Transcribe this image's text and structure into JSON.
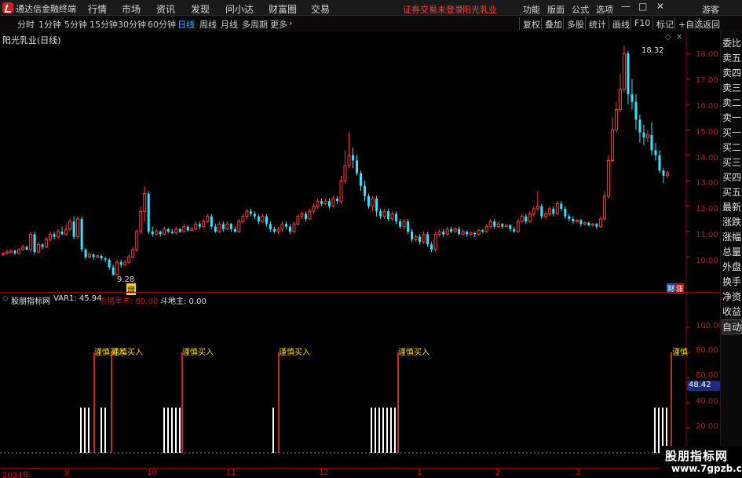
{
  "app": {
    "title": "通达信金融终端",
    "menu": [
      "行情",
      "市场",
      "资讯",
      "发现",
      "问小达",
      "财富圈",
      "交易"
    ],
    "login_status": "证券交易未登录",
    "stock_name": "阳光乳业",
    "right_menu": [
      "功能",
      "版面",
      "公式",
      "选项"
    ],
    "user": "游客"
  },
  "toolbar": {
    "periods": [
      "分时",
      "1分钟",
      "5分钟",
      "15分钟",
      "30分钟",
      "60分钟",
      "日线",
      "周线",
      "月线",
      "多周期",
      "更多"
    ],
    "active_period": "日线",
    "right_buttons": [
      "复权",
      "叠加",
      "多股",
      "统计",
      "画线",
      "F10",
      "标记",
      "+自选",
      "返回"
    ]
  },
  "main_chart": {
    "title": "阳光乳业(日线)",
    "high_label": "18.32",
    "low_label": "9.28",
    "yticks": [
      "18.00",
      "17.00",
      "16.00",
      "15.00",
      "14.00",
      "13.00",
      "12.00",
      "11.00",
      "10.00"
    ],
    "marker_text": "增",
    "corner_tags": [
      "财",
      "涨"
    ]
  },
  "indicator": {
    "name": "股朋指标网",
    "var1_label": "VAR1: 45.94",
    "sell_label": "杀猪宰羊: 80.00",
    "floor_label": "斗地主: 0.00",
    "value_tag": "48.42",
    "buy_signal_texts": [
      "谨慎买入",
      "谨慎买入",
      "谨慎买入",
      "谨慎买入",
      "谨慎买入",
      "谨慎"
    ],
    "yticks": [
      "100.00",
      "80.00",
      "60.00",
      "40.00",
      "20.00"
    ]
  },
  "xaxis": {
    "labels": [
      "2024年",
      "9",
      "10",
      "11",
      "12",
      "1",
      "2",
      "3"
    ]
  },
  "side_panel": {
    "items": [
      "委比",
      "卖五",
      "卖四",
      "卖三",
      "卖二",
      "卖一",
      "买一",
      "买二",
      "买三",
      "买四",
      "买五",
      "最新",
      "涨跌",
      "涨幅",
      "总量",
      "外盘",
      "换手",
      "净资",
      "收益"
    ],
    "auto_button": "自动"
  },
  "watermark": {
    "title": "股朋指标网",
    "url": "www.7gpzb.com"
  },
  "colors": {
    "up": "#ff3a3a",
    "down": "#33e6ff",
    "axis": "#c01818",
    "signal": "#ffd21a",
    "background": "#000000"
  },
  "chart_data": {
    "type": "candlestick",
    "title": "阳光乳业(日线)",
    "ylim": [
      9.0,
      18.5
    ],
    "candles": [
      [
        10.1,
        10.15,
        10.2,
        10.05
      ],
      [
        10.15,
        10.2,
        10.3,
        10.1
      ],
      [
        10.2,
        10.25,
        10.3,
        10.15
      ],
      [
        10.25,
        10.15,
        10.3,
        10.1
      ],
      [
        10.15,
        10.3,
        10.35,
        10.1
      ],
      [
        10.3,
        10.4,
        10.5,
        10.25
      ],
      [
        10.4,
        10.3,
        10.45,
        10.25
      ],
      [
        10.3,
        10.9,
        11.0,
        10.2
      ],
      [
        10.9,
        10.2,
        11.0,
        10.1
      ],
      [
        10.2,
        10.5,
        10.6,
        10.15
      ],
      [
        10.5,
        10.4,
        10.55,
        10.3
      ],
      [
        10.4,
        10.7,
        10.8,
        10.35
      ],
      [
        10.7,
        10.9,
        11.0,
        10.6
      ],
      [
        10.9,
        10.8,
        11.0,
        10.7
      ],
      [
        10.8,
        11.0,
        11.1,
        10.7
      ],
      [
        11.0,
        10.9,
        11.2,
        10.85
      ],
      [
        10.9,
        11.1,
        11.3,
        10.85
      ],
      [
        11.1,
        11.4,
        11.5,
        11.0
      ],
      [
        11.4,
        10.8,
        11.6,
        10.7
      ],
      [
        10.8,
        11.5,
        11.6,
        10.7
      ],
      [
        11.5,
        10.3,
        11.6,
        10.2
      ],
      [
        10.3,
        10.0,
        10.35,
        9.9
      ],
      [
        10.0,
        10.1,
        10.2,
        9.95
      ],
      [
        10.1,
        10.0,
        10.15,
        9.9
      ],
      [
        10.0,
        10.05,
        10.1,
        9.95
      ],
      [
        10.05,
        9.95,
        10.1,
        9.85
      ],
      [
        9.95,
        9.9,
        10.0,
        9.8
      ],
      [
        9.9,
        9.6,
        9.95,
        9.5
      ],
      [
        9.6,
        9.3,
        9.7,
        9.28
      ],
      [
        9.3,
        9.8,
        9.9,
        9.28
      ],
      [
        9.8,
        9.7,
        9.9,
        9.6
      ],
      [
        9.7,
        9.8,
        9.9,
        9.65
      ],
      [
        9.8,
        10.0,
        10.1,
        9.75
      ],
      [
        10.0,
        10.3,
        10.4,
        9.95
      ],
      [
        10.3,
        11.0,
        11.1,
        10.2
      ],
      [
        11.0,
        11.8,
        12.0,
        10.9
      ],
      [
        11.8,
        12.5,
        12.8,
        11.4
      ],
      [
        12.5,
        11.0,
        12.6,
        10.9
      ],
      [
        11.0,
        10.9,
        11.2,
        10.8
      ],
      [
        10.9,
        11.0,
        11.1,
        10.85
      ],
      [
        11.0,
        10.9,
        11.05,
        10.8
      ],
      [
        10.9,
        11.1,
        11.2,
        10.85
      ],
      [
        11.1,
        11.0,
        11.15,
        10.95
      ],
      [
        11.0,
        10.95,
        11.1,
        10.9
      ],
      [
        10.95,
        11.1,
        11.2,
        10.9
      ],
      [
        11.1,
        11.0,
        11.15,
        10.95
      ],
      [
        11.0,
        11.2,
        11.3,
        10.95
      ],
      [
        11.2,
        11.05,
        11.25,
        11.0
      ],
      [
        11.05,
        11.1,
        11.2,
        11.0
      ],
      [
        11.1,
        11.3,
        11.4,
        11.05
      ],
      [
        11.3,
        11.2,
        11.4,
        11.1
      ],
      [
        11.2,
        11.4,
        11.5,
        11.15
      ],
      [
        11.4,
        11.6,
        11.7,
        11.35
      ],
      [
        11.6,
        11.2,
        11.7,
        11.1
      ],
      [
        11.2,
        11.0,
        11.3,
        10.95
      ],
      [
        11.0,
        11.3,
        11.4,
        10.95
      ],
      [
        11.3,
        11.1,
        11.4,
        11.0
      ],
      [
        11.1,
        11.3,
        11.4,
        11.05
      ],
      [
        11.3,
        11.1,
        11.35,
        11.0
      ],
      [
        11.1,
        11.0,
        11.2,
        10.95
      ],
      [
        11.0,
        11.4,
        11.5,
        10.95
      ],
      [
        11.4,
        11.6,
        11.7,
        11.35
      ],
      [
        11.6,
        11.8,
        11.9,
        11.5
      ],
      [
        11.8,
        11.7,
        11.9,
        11.6
      ],
      [
        11.7,
        11.6,
        11.8,
        11.5
      ],
      [
        11.6,
        11.4,
        11.7,
        11.3
      ],
      [
        11.4,
        11.6,
        11.7,
        11.35
      ],
      [
        11.6,
        11.3,
        11.7,
        11.2
      ],
      [
        11.3,
        11.1,
        11.4,
        11.0
      ],
      [
        11.1,
        11.0,
        11.2,
        10.95
      ],
      [
        11.0,
        11.1,
        11.2,
        10.9
      ],
      [
        11.1,
        11.3,
        11.4,
        11.0
      ],
      [
        11.3,
        11.2,
        11.4,
        11.1
      ],
      [
        11.2,
        11.0,
        11.3,
        10.9
      ],
      [
        11.0,
        11.3,
        11.4,
        10.95
      ],
      [
        11.3,
        11.6,
        11.7,
        11.25
      ],
      [
        11.6,
        11.7,
        11.8,
        11.5
      ],
      [
        11.7,
        11.5,
        11.8,
        11.4
      ],
      [
        11.5,
        11.8,
        11.9,
        11.45
      ],
      [
        11.8,
        12.0,
        12.1,
        11.7
      ],
      [
        12.0,
        12.2,
        12.3,
        11.9
      ],
      [
        12.2,
        12.1,
        12.3,
        12.0
      ],
      [
        12.1,
        12.2,
        12.3,
        12.05
      ],
      [
        12.2,
        12.0,
        12.3,
        11.9
      ],
      [
        12.0,
        12.3,
        12.4,
        11.95
      ],
      [
        12.3,
        12.2,
        12.4,
        12.1
      ],
      [
        12.2,
        13.0,
        13.2,
        12.1
      ],
      [
        13.0,
        13.6,
        14.2,
        12.9
      ],
      [
        13.6,
        14.0,
        14.9,
        13.5
      ],
      [
        14.0,
        13.8,
        14.3,
        13.5
      ],
      [
        13.8,
        13.3,
        14.0,
        13.2
      ],
      [
        13.3,
        12.8,
        13.4,
        12.6
      ],
      [
        12.8,
        12.4,
        13.0,
        12.2
      ],
      [
        12.4,
        12.0,
        12.5,
        11.9
      ],
      [
        12.0,
        12.3,
        12.4,
        11.8
      ],
      [
        12.3,
        11.8,
        12.4,
        11.6
      ],
      [
        11.8,
        11.6,
        11.9,
        11.5
      ],
      [
        11.6,
        11.8,
        11.9,
        11.5
      ],
      [
        11.8,
        11.5,
        11.9,
        11.4
      ],
      [
        11.5,
        11.7,
        11.8,
        11.4
      ],
      [
        11.7,
        11.4,
        11.8,
        11.3
      ],
      [
        11.4,
        11.2,
        11.5,
        11.1
      ],
      [
        11.2,
        11.4,
        11.5,
        11.1
      ],
      [
        11.4,
        11.0,
        11.5,
        10.9
      ],
      [
        11.0,
        10.7,
        11.1,
        10.6
      ],
      [
        10.7,
        10.8,
        10.9,
        10.6
      ],
      [
        10.8,
        10.6,
        10.9,
        10.5
      ],
      [
        10.6,
        10.9,
        11.0,
        10.5
      ],
      [
        10.9,
        10.5,
        11.0,
        10.4
      ],
      [
        10.5,
        10.3,
        10.6,
        10.2
      ],
      [
        10.3,
        10.9,
        11.0,
        10.2
      ],
      [
        10.9,
        11.0,
        11.1,
        10.8
      ],
      [
        11.0,
        10.9,
        11.1,
        10.8
      ],
      [
        10.9,
        11.1,
        11.2,
        10.85
      ],
      [
        11.1,
        11.0,
        11.2,
        10.95
      ],
      [
        11.0,
        11.1,
        11.2,
        10.95
      ],
      [
        11.1,
        10.9,
        11.2,
        10.85
      ],
      [
        10.9,
        11.0,
        11.1,
        10.85
      ],
      [
        11.0,
        10.9,
        11.05,
        10.8
      ],
      [
        10.9,
        10.95,
        11.0,
        10.85
      ],
      [
        10.95,
        10.9,
        11.0,
        10.8
      ],
      [
        10.9,
        11.05,
        11.1,
        10.85
      ],
      [
        11.05,
        11.0,
        11.1,
        10.95
      ],
      [
        11.0,
        11.2,
        11.3,
        10.95
      ],
      [
        11.2,
        11.4,
        11.5,
        11.15
      ],
      [
        11.4,
        11.2,
        11.5,
        11.1
      ],
      [
        11.2,
        11.3,
        11.4,
        11.15
      ],
      [
        11.3,
        11.2,
        11.35,
        11.1
      ],
      [
        11.2,
        11.25,
        11.3,
        11.15
      ],
      [
        11.25,
        11.1,
        11.3,
        11.0
      ],
      [
        11.1,
        11.0,
        11.2,
        10.95
      ],
      [
        11.0,
        11.4,
        11.5,
        10.95
      ],
      [
        11.4,
        11.6,
        11.7,
        11.35
      ],
      [
        11.6,
        11.4,
        11.7,
        11.3
      ],
      [
        11.4,
        11.7,
        11.8,
        11.35
      ],
      [
        11.7,
        11.9,
        12.0,
        11.6
      ],
      [
        11.9,
        12.0,
        12.6,
        11.8
      ],
      [
        12.0,
        11.6,
        12.1,
        11.5
      ],
      [
        11.6,
        11.7,
        11.8,
        11.5
      ],
      [
        11.7,
        11.9,
        12.0,
        11.6
      ],
      [
        11.9,
        11.7,
        12.0,
        11.6
      ],
      [
        11.7,
        12.1,
        12.2,
        11.65
      ],
      [
        12.1,
        11.9,
        12.2,
        11.8
      ],
      [
        11.9,
        11.6,
        12.0,
        11.5
      ],
      [
        11.6,
        11.5,
        11.7,
        11.4
      ],
      [
        11.5,
        11.4,
        11.6,
        11.3
      ],
      [
        11.4,
        11.45,
        11.5,
        11.35
      ],
      [
        11.45,
        11.3,
        11.5,
        11.2
      ],
      [
        11.3,
        11.35,
        11.4,
        11.25
      ],
      [
        11.35,
        11.25,
        11.4,
        11.2
      ],
      [
        11.25,
        11.3,
        11.35,
        11.2
      ],
      [
        11.3,
        11.2,
        11.35,
        11.1
      ],
      [
        11.2,
        11.5,
        11.6,
        11.15
      ],
      [
        11.5,
        12.4,
        12.6,
        11.45
      ],
      [
        12.4,
        13.8,
        14.0,
        12.3
      ],
      [
        13.8,
        15.0,
        15.5,
        13.7
      ],
      [
        15.0,
        15.8,
        16.1,
        14.9
      ],
      [
        15.8,
        16.6,
        17.2,
        15.7
      ],
      [
        16.6,
        18.0,
        18.32,
        16.5
      ],
      [
        18.0,
        16.4,
        18.1,
        16.0
      ],
      [
        16.4,
        16.1,
        17.0,
        15.8
      ],
      [
        16.1,
        15.4,
        16.4,
        15.0
      ],
      [
        15.4,
        14.9,
        15.6,
        14.5
      ],
      [
        14.9,
        14.7,
        15.2,
        14.4
      ],
      [
        14.7,
        14.8,
        15.0,
        14.5
      ],
      [
        14.8,
        14.2,
        15.3,
        14.0
      ],
      [
        14.2,
        14.0,
        14.5,
        13.8
      ],
      [
        14.0,
        13.4,
        14.2,
        13.3
      ],
      [
        13.4,
        13.2,
        13.5,
        12.9
      ],
      [
        13.2,
        13.3,
        13.4,
        13.1
      ]
    ],
    "indicator_var1": 45.94,
    "indicator_sell_level": 80.0,
    "indicator_floor_level": 0.0,
    "indicator_ylim": [
      0,
      120
    ]
  }
}
